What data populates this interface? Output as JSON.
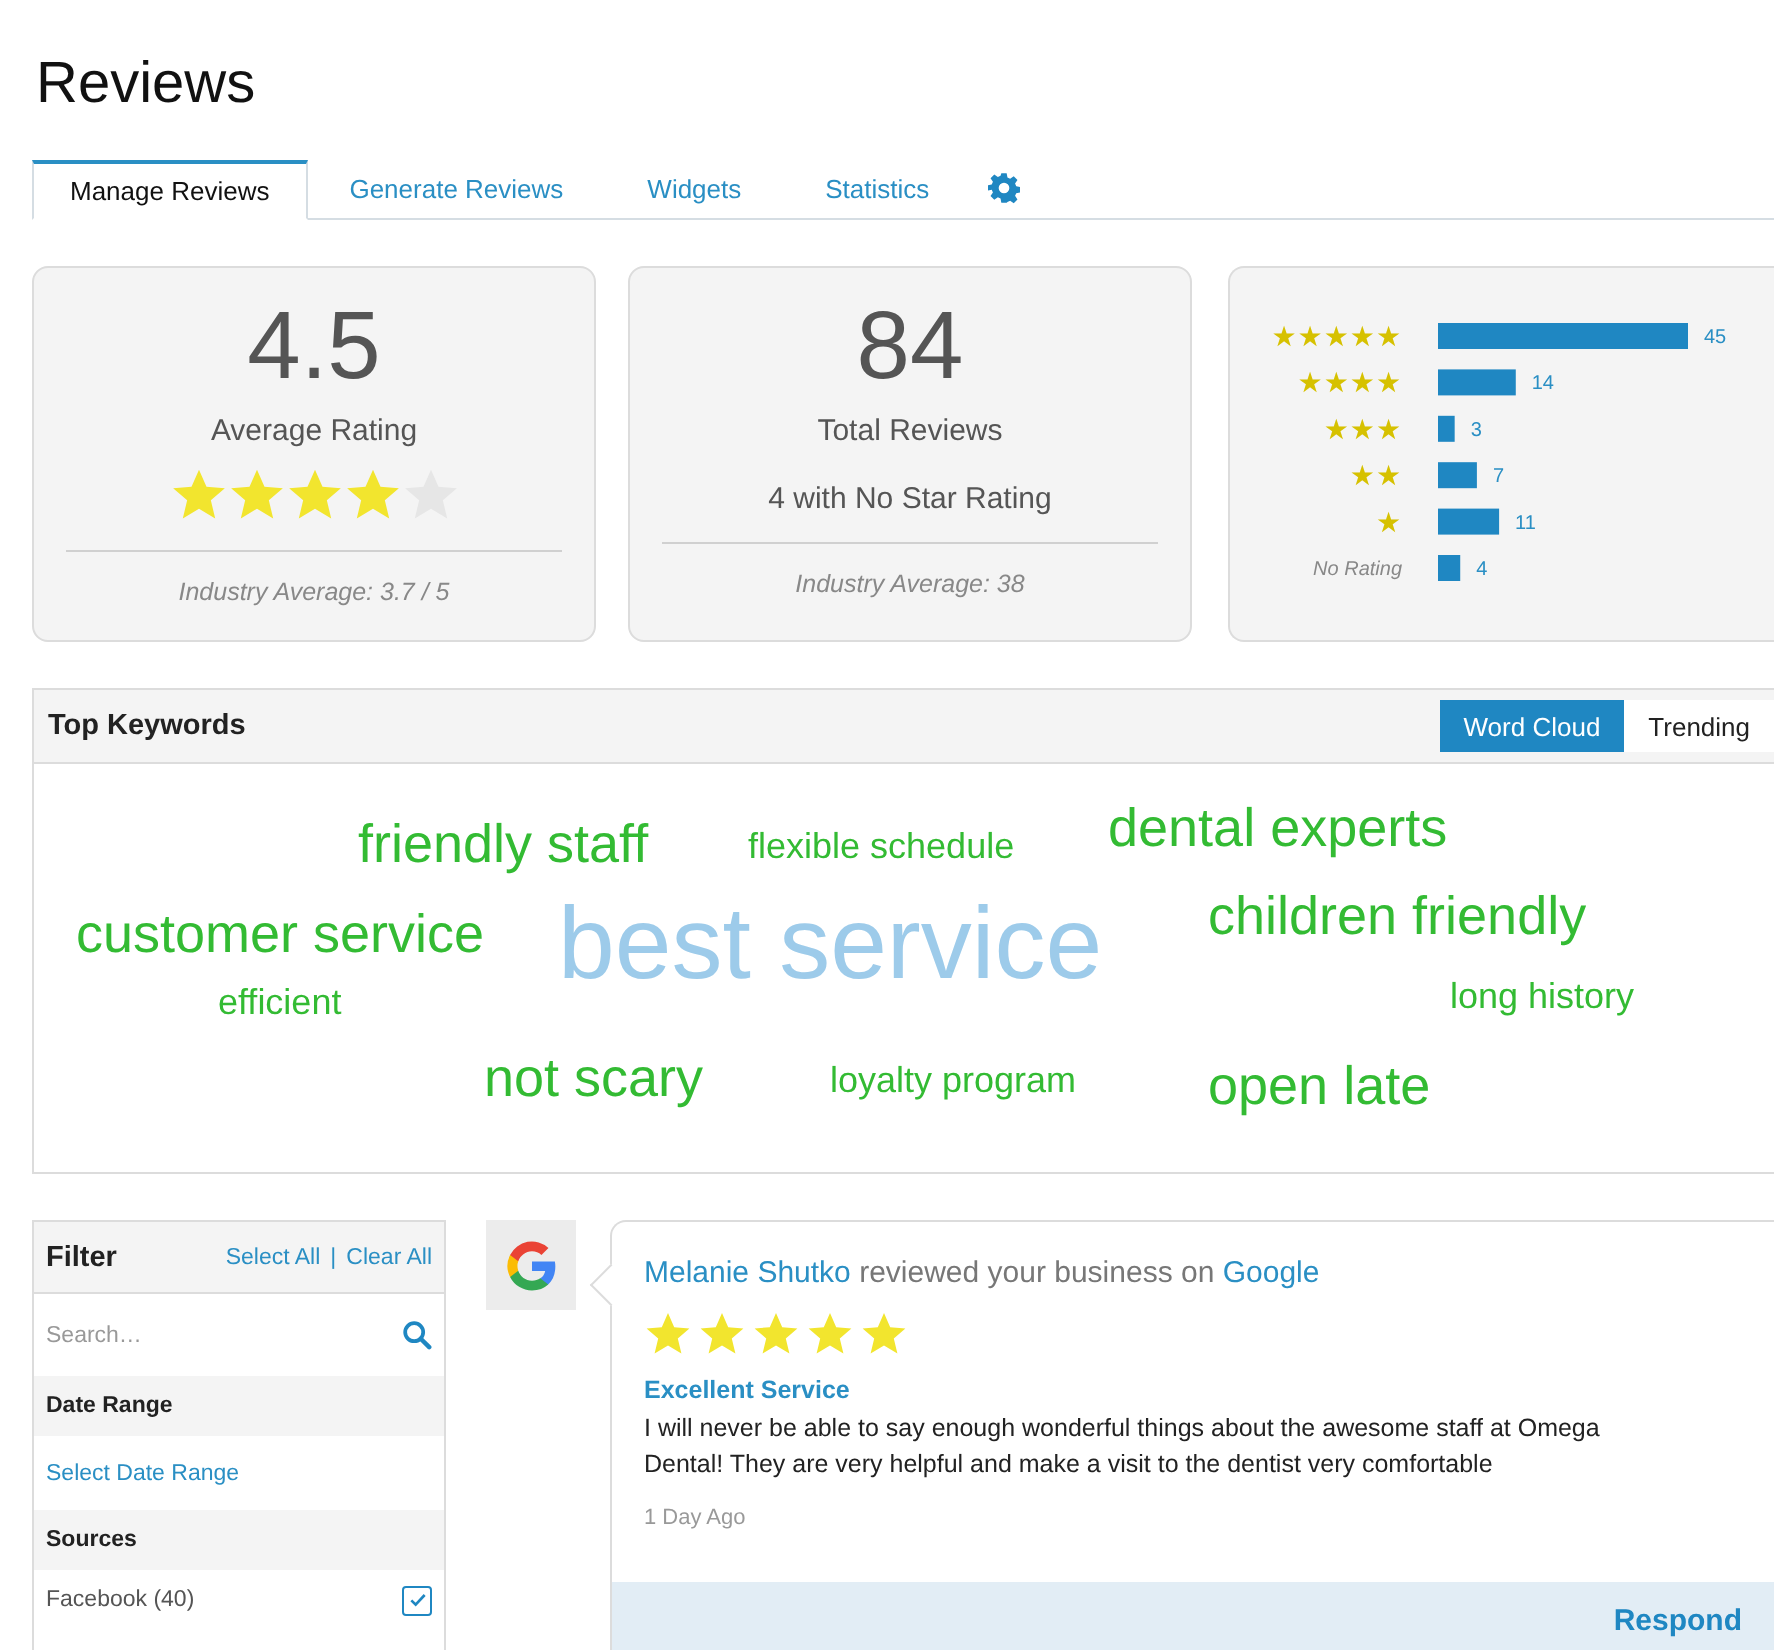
{
  "page": {
    "title": "Reviews"
  },
  "tabs": [
    {
      "label": "Manage Reviews",
      "selected": true
    },
    {
      "label": "Generate Reviews",
      "selected": false
    },
    {
      "label": "Widgets",
      "selected": false
    },
    {
      "label": "Statistics",
      "selected": false
    }
  ],
  "average_card": {
    "value": "4.5",
    "label": "Average Rating",
    "stars": 4,
    "footer": "Industry Average: 3.7 / 5"
  },
  "total_card": {
    "value": "84",
    "label": "Total Reviews",
    "note": "4 with No Star Rating",
    "footer": "Industry Average: 38"
  },
  "distribution": {
    "chart_data": {
      "type": "bar",
      "orientation": "horizontal",
      "categories": [
        "★★★★★",
        "★★★★",
        "★★★",
        "★★",
        "★",
        "No Rating"
      ],
      "series": [
        {
          "color": "#1f87c2",
          "values": [
            45,
            14,
            3,
            7,
            11,
            4
          ]
        }
      ],
      "data_labels": true
    }
  },
  "keywords": {
    "title": "Top Keywords",
    "views": [
      {
        "label": "Word Cloud",
        "selected": true
      },
      {
        "label": "Trending",
        "selected": false
      }
    ],
    "words": [
      {
        "text": "friendly staff",
        "kind": "medium",
        "color": "#33bb33"
      },
      {
        "text": "flexible schedule",
        "kind": "small",
        "color": "#33bb33"
      },
      {
        "text": "dental experts",
        "kind": "medium",
        "color": "#33bb33"
      },
      {
        "text": "customer service",
        "kind": "medium",
        "color": "#33bb33"
      },
      {
        "text": "best service",
        "kind": "large",
        "color": "#9dcbea"
      },
      {
        "text": "children friendly",
        "kind": "medium",
        "color": "#33bb33"
      },
      {
        "text": "efficient",
        "kind": "small",
        "color": "#33bb33"
      },
      {
        "text": "long history",
        "kind": "small",
        "color": "#33bb33"
      },
      {
        "text": "not scary",
        "kind": "medium",
        "color": "#33bb33"
      },
      {
        "text": "loyalty program",
        "kind": "small",
        "color": "#33bb33"
      },
      {
        "text": "open late",
        "kind": "medium",
        "color": "#33bb33"
      }
    ]
  },
  "filter": {
    "title": "Filter",
    "select_all": "Select All",
    "separator": "|",
    "clear_all": "Clear All",
    "search": {
      "placeholder": "Search…"
    },
    "date_range": {
      "heading": "Date Range",
      "link": "Select Date Range"
    },
    "sources": {
      "heading": "Sources",
      "items": [
        {
          "label": "Facebook (40)",
          "checked": true
        }
      ]
    }
  },
  "review": {
    "reviewer": "Melanie Shutko",
    "action": "reviewed your business on",
    "source": "Google",
    "stars": 5,
    "title": "Excellent Service",
    "body": "I will never be able to say enough wonderful things about the awesome staff at Omega Dental! They are very helpful and make a visit to the dentist very comfortable",
    "time": "1 Day Ago",
    "button": "Respond"
  }
}
